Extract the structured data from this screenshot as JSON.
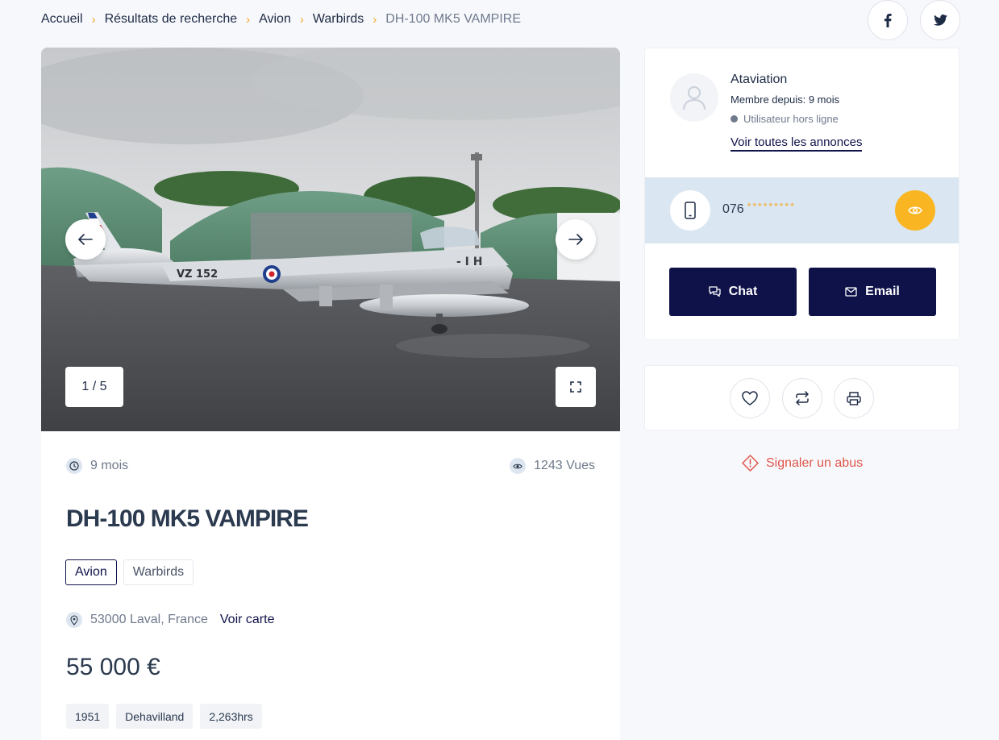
{
  "breadcrumb": {
    "items": [
      "Accueil",
      "Résultats de recherche",
      "Avion",
      "Warbirds",
      "DH-100 MK5 VAMPIRE"
    ],
    "separator": "›"
  },
  "social": {
    "facebook_icon": "facebook-icon",
    "twitter_icon": "twitter-icon"
  },
  "gallery": {
    "counter": "1 / 5",
    "aircraft_marking": "VZ 152",
    "tail_marking": "- I H"
  },
  "listing": {
    "age": "9 mois",
    "views": "1243 Vues",
    "title": "DH-100 MK5 VAMPIRE",
    "tags": [
      "Avion",
      "Warbirds"
    ],
    "location": "53000 Laval, France",
    "map_link": "Voir carte",
    "price": "55 000 €",
    "specs": [
      "1951",
      "Dehavilland",
      "2,263hrs"
    ]
  },
  "seller": {
    "name": "Ataviation",
    "member_since": "Membre depuis: 9 mois",
    "status": "Utilisateur hors ligne",
    "all_ads_link": "Voir toutes les annonces",
    "phone_prefix": "076",
    "phone_mask": "*********",
    "chat_label": "Chat",
    "email_label": "Email"
  },
  "report": {
    "label": "Signaler un abus"
  },
  "colors": {
    "accent": "#f5a623",
    "primary": "#0f1149",
    "phone_bar": "#dae6f1",
    "danger": "#e0574a"
  }
}
